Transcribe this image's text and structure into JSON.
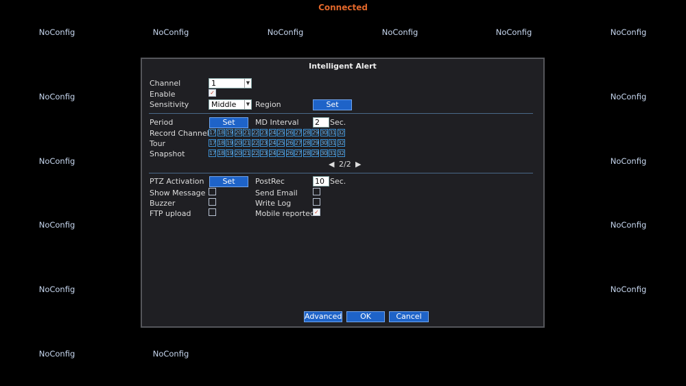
{
  "status": "Connected",
  "camera_labels": {
    "r1c1": "NoConfig",
    "r1c2": "NoConfig",
    "r1c3": "NoConfig",
    "r1c4": "NoConfig",
    "r1c5": "NoConfig",
    "r1c6": "NoConfig",
    "r2c1": "NoConfig",
    "r2c6": "NoConfig",
    "r3c1": "NoConfig",
    "r3c6": "NoConfig",
    "r4c1": "NoConfig",
    "r4c6": "NoConfig",
    "r5c1": "NoConfig",
    "r5c6": "NoConfig",
    "r6c1": "NoConfig",
    "r6c2": "NoConfig"
  },
  "dialog": {
    "title": "Intelligent Alert",
    "channel": {
      "label": "Channel",
      "value": "1"
    },
    "enable": {
      "label": "Enable",
      "checked": true
    },
    "sensitivity": {
      "label": "Sensitivity",
      "value": "Middle"
    },
    "region": {
      "label": "Region",
      "button": "Set"
    },
    "period": {
      "label": "Period",
      "button": "Set"
    },
    "md_interval": {
      "label": "MD Interval",
      "value": "2",
      "unit": "Sec."
    },
    "record_channel": {
      "label": "Record Channel"
    },
    "tour": {
      "label": "Tour"
    },
    "snapshot": {
      "label": "Snapshot"
    },
    "channels": [
      "17",
      "18",
      "19",
      "20",
      "21",
      "22",
      "23",
      "24",
      "25",
      "26",
      "27",
      "28",
      "29",
      "30",
      "31",
      "32"
    ],
    "pager": {
      "prev": "◀",
      "text": "2/2",
      "next": "▶"
    },
    "ptz_activation": {
      "label": "PTZ Activation",
      "button": "Set"
    },
    "postrec": {
      "label": "PostRec",
      "value": "10",
      "unit": "Sec."
    },
    "show_message": {
      "label": "Show Message",
      "checked": false
    },
    "send_email": {
      "label": "Send Email",
      "checked": false
    },
    "buzzer": {
      "label": "Buzzer",
      "checked": false
    },
    "write_log": {
      "label": "Write Log",
      "checked": false
    },
    "ftp_upload": {
      "label": "FTP upload",
      "checked": false
    },
    "mobile_reported": {
      "label": "Mobile reported",
      "checked": true
    },
    "buttons": {
      "advanced": "Advanced",
      "ok": "OK",
      "cancel": "Cancel"
    }
  },
  "colors": {
    "status": "#e2672a",
    "accent": "#1e63c8",
    "grid": "#3c93d8"
  }
}
